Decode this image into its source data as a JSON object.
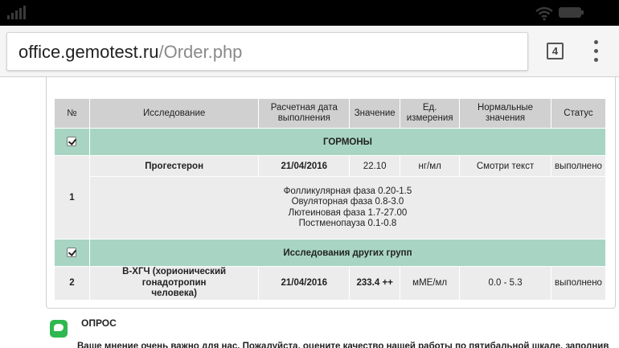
{
  "browser": {
    "url_host": "office.gemotest.ru",
    "url_path": "/Order.php",
    "tab_count": "4"
  },
  "table": {
    "headers": {
      "num": "№",
      "study": "Исследование",
      "date_line1": "Расчетная дата",
      "date_line2": "выполнения",
      "value": "Значение",
      "unit_line1": "Ед.",
      "unit_line2": "измерения",
      "normal_line1": "Нормальные",
      "normal_line2": "значения",
      "status": "Статус"
    },
    "group1": {
      "name": "ГОРМОНЫ",
      "checked": true,
      "test": {
        "num": "1",
        "name": "Прогестерон",
        "date": "21/04/2016",
        "value": "22.10",
        "unit": "нг/мл",
        "normal": "Смотри текст",
        "status": "выполнено"
      },
      "note_lines": [
        "Фолликулярная фаза 0.20-1.5",
        "Овуляторная фаза 0.8-3.0",
        "Лютеиновая фаза 1.7-27.00",
        "Постменопауза 0.1-0.8"
      ]
    },
    "group2": {
      "name": "Исследования других групп",
      "checked": true,
      "test": {
        "num": "2",
        "name_line1": "В-ХГЧ (хорионический гонадотропин",
        "name_line2": "человека)",
        "date": "21/04/2016",
        "value": "233.4 ++",
        "unit": "мМЕ/мл",
        "normal": "0.0 - 5.3",
        "status": "выполнено"
      }
    }
  },
  "survey": {
    "title": "ОПРОС",
    "text": "Ваше мнение очень важно для нас. Пожалуйста, оцените качество нашей работы по пятибальной шкале, заполнив"
  },
  "colors": {
    "header_bg": "#d0d0d0",
    "group_bg": "#a8d5c3",
    "row_bg": "#ececec",
    "survey_icon": "#2fb84f"
  }
}
